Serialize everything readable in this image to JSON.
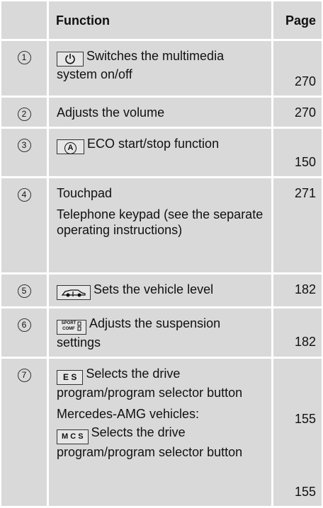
{
  "header": {
    "function": "Function",
    "page": "Page"
  },
  "rows": [
    {
      "num": "1",
      "icon": "power-icon",
      "text": "Switches the multimedia system on/off",
      "page": "270"
    },
    {
      "num": "2",
      "text": "Adjusts the volume",
      "page": "270"
    },
    {
      "num": "3",
      "icon": "eco-a-icon",
      "key_text": "A",
      "text": "ECO start/stop function",
      "page": "150"
    },
    {
      "num": "4",
      "text": "Touchpad",
      "page": "271",
      "text2": "Telephone keypad (see the separate operating instructions)"
    },
    {
      "num": "5",
      "icon": "vehicle-level-icon",
      "text": "Sets the vehicle level",
      "page": "182"
    },
    {
      "num": "6",
      "icon": "sport-comfort-icon",
      "key_text": "SPORT COMF",
      "text": "Adjusts the suspension settings",
      "page": "182"
    },
    {
      "num": "7",
      "icon": "drive-program-icon",
      "key_text": "E S",
      "text": "Selects the drive program/program selector button",
      "page": "155",
      "sub_heading": "Mercedes-AMG vehicles:",
      "sub_icon": "amg-drive-program-icon",
      "sub_key_text": "M C S",
      "sub_text": "Selects the drive program/program selector button",
      "sub_page": "155"
    }
  ]
}
